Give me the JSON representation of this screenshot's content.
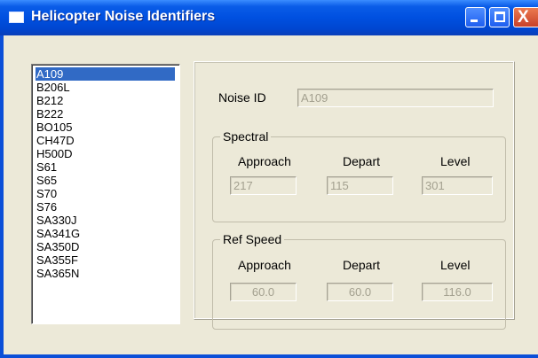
{
  "window": {
    "title": "Helicopter Noise Identifiers",
    "icon": "window-app-icon",
    "controls": {
      "minimize_icon": "minimize-icon",
      "maximize_icon": "maximize-icon",
      "close_glyph": "X"
    }
  },
  "list": {
    "items": [
      "A109",
      "B206L",
      "B212",
      "B222",
      "BO105",
      "CH47D",
      "H500D",
      "S61",
      "S65",
      "S70",
      "S76",
      "SA330J",
      "SA341G",
      "SA350D",
      "SA355F",
      "SA365N"
    ],
    "selected": "A109"
  },
  "details": {
    "noise_id_label": "Noise ID",
    "noise_id_value": "A109",
    "spectral": {
      "title": "Spectral",
      "headers": [
        "Approach",
        "Depart",
        "Level"
      ],
      "values": [
        "217",
        "115",
        "301"
      ]
    },
    "ref_speed": {
      "title": "Ref Speed",
      "headers": [
        "Approach",
        "Depart",
        "Level"
      ],
      "values": [
        "60.0",
        "60.0",
        "116.0"
      ]
    }
  },
  "colors": {
    "titlebar": "#0050e0",
    "selection": "#316ac5",
    "dialog_face": "#ece9d8",
    "disabled_text": "#a3a08f"
  }
}
